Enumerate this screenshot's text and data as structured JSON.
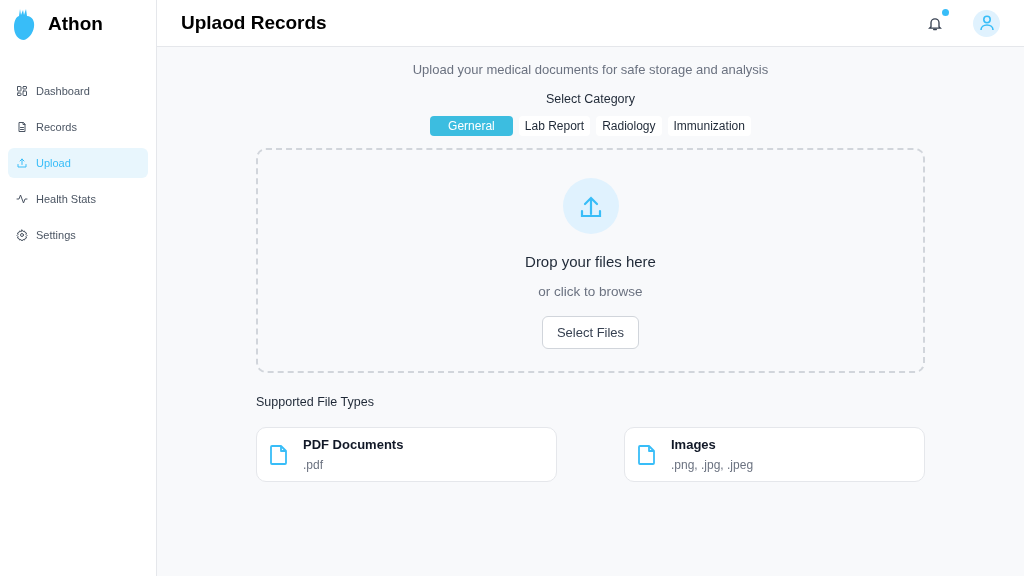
{
  "brand": {
    "name": "Athon"
  },
  "sidebar": {
    "items": [
      {
        "label": "Dashboard",
        "kind": "grid",
        "selected": false
      },
      {
        "label": "Records",
        "kind": "doc",
        "selected": false
      },
      {
        "label": "Upload",
        "kind": "upload",
        "selected": true
      },
      {
        "label": "Health Stats",
        "kind": "pulse",
        "selected": false
      },
      {
        "label": "Settings",
        "kind": "gear",
        "selected": false
      }
    ]
  },
  "header": {
    "title": "Uplaod Records",
    "notification_dot": true
  },
  "intro": "Upload your medical documents for safe storage and analysis",
  "category_label": "Select Category",
  "categories": [
    {
      "label": "Gerneral",
      "selected": true
    },
    {
      "label": "Lab Report",
      "selected": false
    },
    {
      "label": "Radiology",
      "selected": false
    },
    {
      "label": "Immunization",
      "selected": false
    }
  ],
  "dropzone": {
    "title": "Drop your files here",
    "subtitle": "or click to browse",
    "button": "Select Files"
  },
  "supported": {
    "title": "Supported File Types",
    "types": [
      {
        "name": "PDF Documents",
        "extensions": ".pdf"
      },
      {
        "name": "Images",
        "extensions": ".png, .jpg, .jpeg"
      }
    ]
  }
}
